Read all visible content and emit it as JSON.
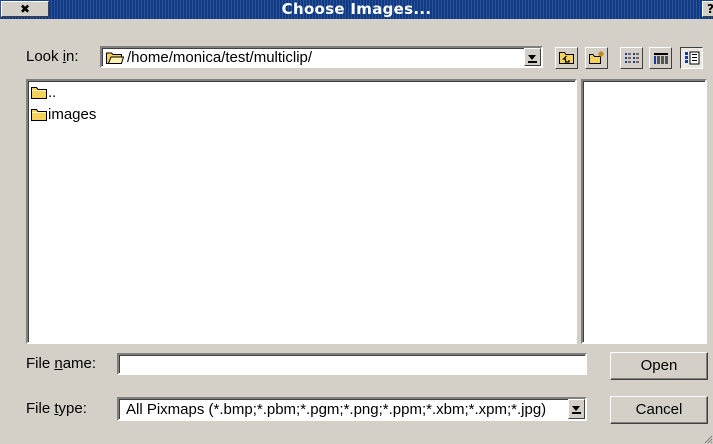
{
  "window": {
    "title": "Choose Images...",
    "close_label": "✖",
    "help_label": "?"
  },
  "lookin": {
    "label_pre": "Look ",
    "label_mnemonic": "i",
    "label_post": "n:",
    "path": "/home/monica/test/multiclip/"
  },
  "toolbar": {
    "icons": [
      "folder-up-icon",
      "new-folder-icon",
      "list-view-icon",
      "detail-view-icon",
      "preview-icon"
    ]
  },
  "files": [
    {
      "name": "..",
      "icon": "folder-icon"
    },
    {
      "name": "images",
      "icon": "folder-icon"
    }
  ],
  "filename": {
    "label_pre": "File ",
    "label_mnemonic": "n",
    "label_post": "ame:",
    "value": ""
  },
  "filetype": {
    "label_pre": "File ",
    "label_mnemonic": "t",
    "label_post": "ype:",
    "value": "All Pixmaps (*.bmp;*.pbm;*.pgm;*.png;*.ppm;*.xbm;*.xpm;*.jpg)"
  },
  "buttons": {
    "open": "Open",
    "cancel": "Cancel"
  },
  "colors": {
    "titlebar": "#0f3a86",
    "face": "#d4d0c8",
    "folder": "#f5d25a"
  }
}
